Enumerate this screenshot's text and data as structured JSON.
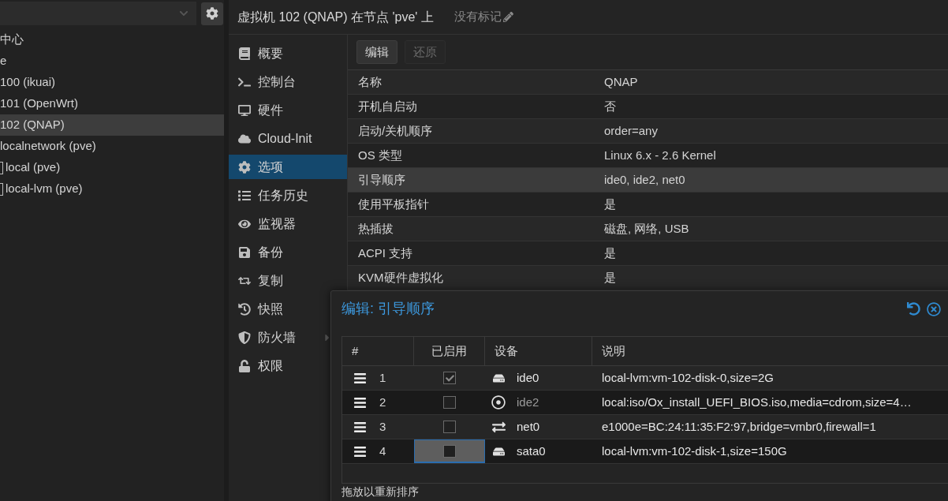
{
  "sidebar": {
    "tree": [
      {
        "label": "中心",
        "selected": false,
        "storage": false
      },
      {
        "label": "e",
        "selected": false,
        "storage": false
      },
      {
        "label": "100 (ikuai)",
        "selected": false,
        "storage": false
      },
      {
        "label": "101 (OpenWrt)",
        "selected": false,
        "storage": false
      },
      {
        "label": "102 (QNAP)",
        "selected": true,
        "storage": false
      },
      {
        "label": "localnetwork (pve)",
        "selected": false,
        "storage": false
      },
      {
        "label": "local (pve)",
        "selected": false,
        "storage": true
      },
      {
        "label": "local-lvm (pve)",
        "selected": false,
        "storage": true
      }
    ]
  },
  "header": {
    "title": "虚拟机 102 (QNAP) 在节点 'pve' 上",
    "tags": "没有标记"
  },
  "nav": [
    {
      "label": "概要",
      "selected": false,
      "has_submenu": false
    },
    {
      "label": "控制台",
      "selected": false,
      "has_submenu": false
    },
    {
      "label": "硬件",
      "selected": false,
      "has_submenu": false
    },
    {
      "label": "Cloud-Init",
      "selected": false,
      "has_submenu": false
    },
    {
      "label": "选项",
      "selected": true,
      "has_submenu": false
    },
    {
      "label": "任务历史",
      "selected": false,
      "has_submenu": false
    },
    {
      "label": "监视器",
      "selected": false,
      "has_submenu": false
    },
    {
      "label": "备份",
      "selected": false,
      "has_submenu": false
    },
    {
      "label": "复制",
      "selected": false,
      "has_submenu": false
    },
    {
      "label": "快照",
      "selected": false,
      "has_submenu": false
    },
    {
      "label": "防火墙",
      "selected": false,
      "has_submenu": true
    },
    {
      "label": "权限",
      "selected": false,
      "has_submenu": false
    }
  ],
  "toolbar": [
    {
      "label": "编辑",
      "disabled": false
    },
    {
      "label": "还原",
      "disabled": true
    }
  ],
  "options": [
    {
      "name": "名称",
      "value": "QNAP",
      "selected": false
    },
    {
      "name": "开机自启动",
      "value": "否",
      "selected": false
    },
    {
      "name": "启动/关机顺序",
      "value": "order=any",
      "selected": false
    },
    {
      "name": "OS 类型",
      "value": "Linux 6.x - 2.6 Kernel",
      "selected": false
    },
    {
      "name": "引导顺序",
      "value": "ide0, ide2, net0",
      "selected": true
    },
    {
      "name": "使用平板指针",
      "value": "是",
      "selected": false
    },
    {
      "name": "热插拔",
      "value": "磁盘, 网络, USB",
      "selected": false
    },
    {
      "name": "ACPI 支持",
      "value": "是",
      "selected": false
    },
    {
      "name": "KVM硬件虚拟化",
      "value": "是",
      "selected": false
    }
  ],
  "dialog": {
    "title": "编辑: 引导顺序",
    "columns": [
      "#",
      "已启用",
      "设备",
      "说明"
    ],
    "rows": [
      {
        "order": "1",
        "enabled": true,
        "focused": false,
        "dimmed": false,
        "kind": "disk",
        "device": "ide0",
        "description": "local-lvm:vm-102-disk-0,size=2G"
      },
      {
        "order": "2",
        "enabled": false,
        "focused": false,
        "dimmed": true,
        "kind": "cdrom",
        "device": "ide2",
        "description": "local:iso/Ox_install_UEFI_BIOS.iso,media=cdrom,size=4…"
      },
      {
        "order": "3",
        "enabled": false,
        "focused": false,
        "dimmed": false,
        "kind": "network",
        "device": "net0",
        "description": "e1000e=BC:24:11:35:F2:97,bridge=vmbr0,firewall=1"
      },
      {
        "order": "4",
        "enabled": false,
        "focused": true,
        "dimmed": false,
        "kind": "disk",
        "device": "sata0",
        "description": "local-lvm:vm-102-disk-1,size=150G"
      }
    ],
    "hint": "拖放以重新排序"
  }
}
